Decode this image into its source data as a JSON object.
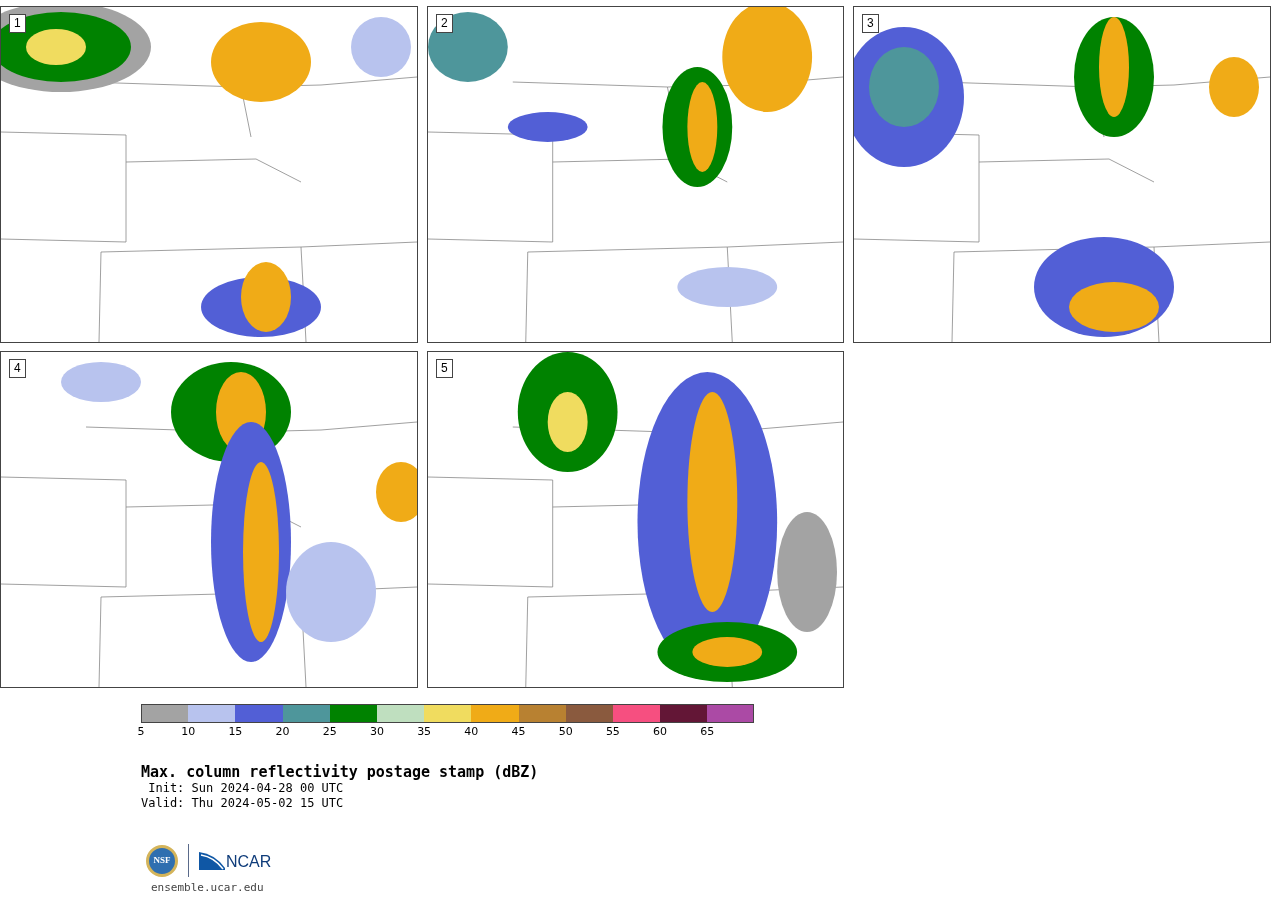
{
  "panels": [
    {
      "label": "1",
      "kind": "picture"
    },
    {
      "label": "2",
      "kind": "picture"
    },
    {
      "label": "3",
      "kind": "picture"
    },
    {
      "label": "4",
      "kind": "picture"
    },
    {
      "label": "5",
      "kind": "picture"
    }
  ],
  "colorbar": [
    {
      "tick": "5",
      "color": "#a3a3a3"
    },
    {
      "tick": "10",
      "color": "#b8c3ee"
    },
    {
      "tick": "15",
      "color": "#525fd6"
    },
    {
      "tick": "20",
      "color": "#4e969b"
    },
    {
      "tick": "25",
      "color": "#008200"
    },
    {
      "tick": "30",
      "color": "#bfdfbf"
    },
    {
      "tick": "35",
      "color": "#f0dc5f"
    },
    {
      "tick": "40",
      "color": "#f0ab17"
    },
    {
      "tick": "45",
      "color": "#b88131"
    },
    {
      "tick": "50",
      "color": "#8a5a3e"
    },
    {
      "tick": "55",
      "color": "#f64f80"
    },
    {
      "tick": "60",
      "color": "#631636"
    },
    {
      "tick": "65",
      "color": "#ab4aa5"
    }
  ],
  "title": "Max. column reflectivity postage stamp (dBZ)",
  "init": " Init: Sun 2024-04-28 00 UTC",
  "valid": "Valid: Thu 2024-05-02 15 UTC",
  "logos": {
    "nsf": "NSF",
    "ncar": "NCAR"
  },
  "site": "ensemble.ucar.edu"
}
